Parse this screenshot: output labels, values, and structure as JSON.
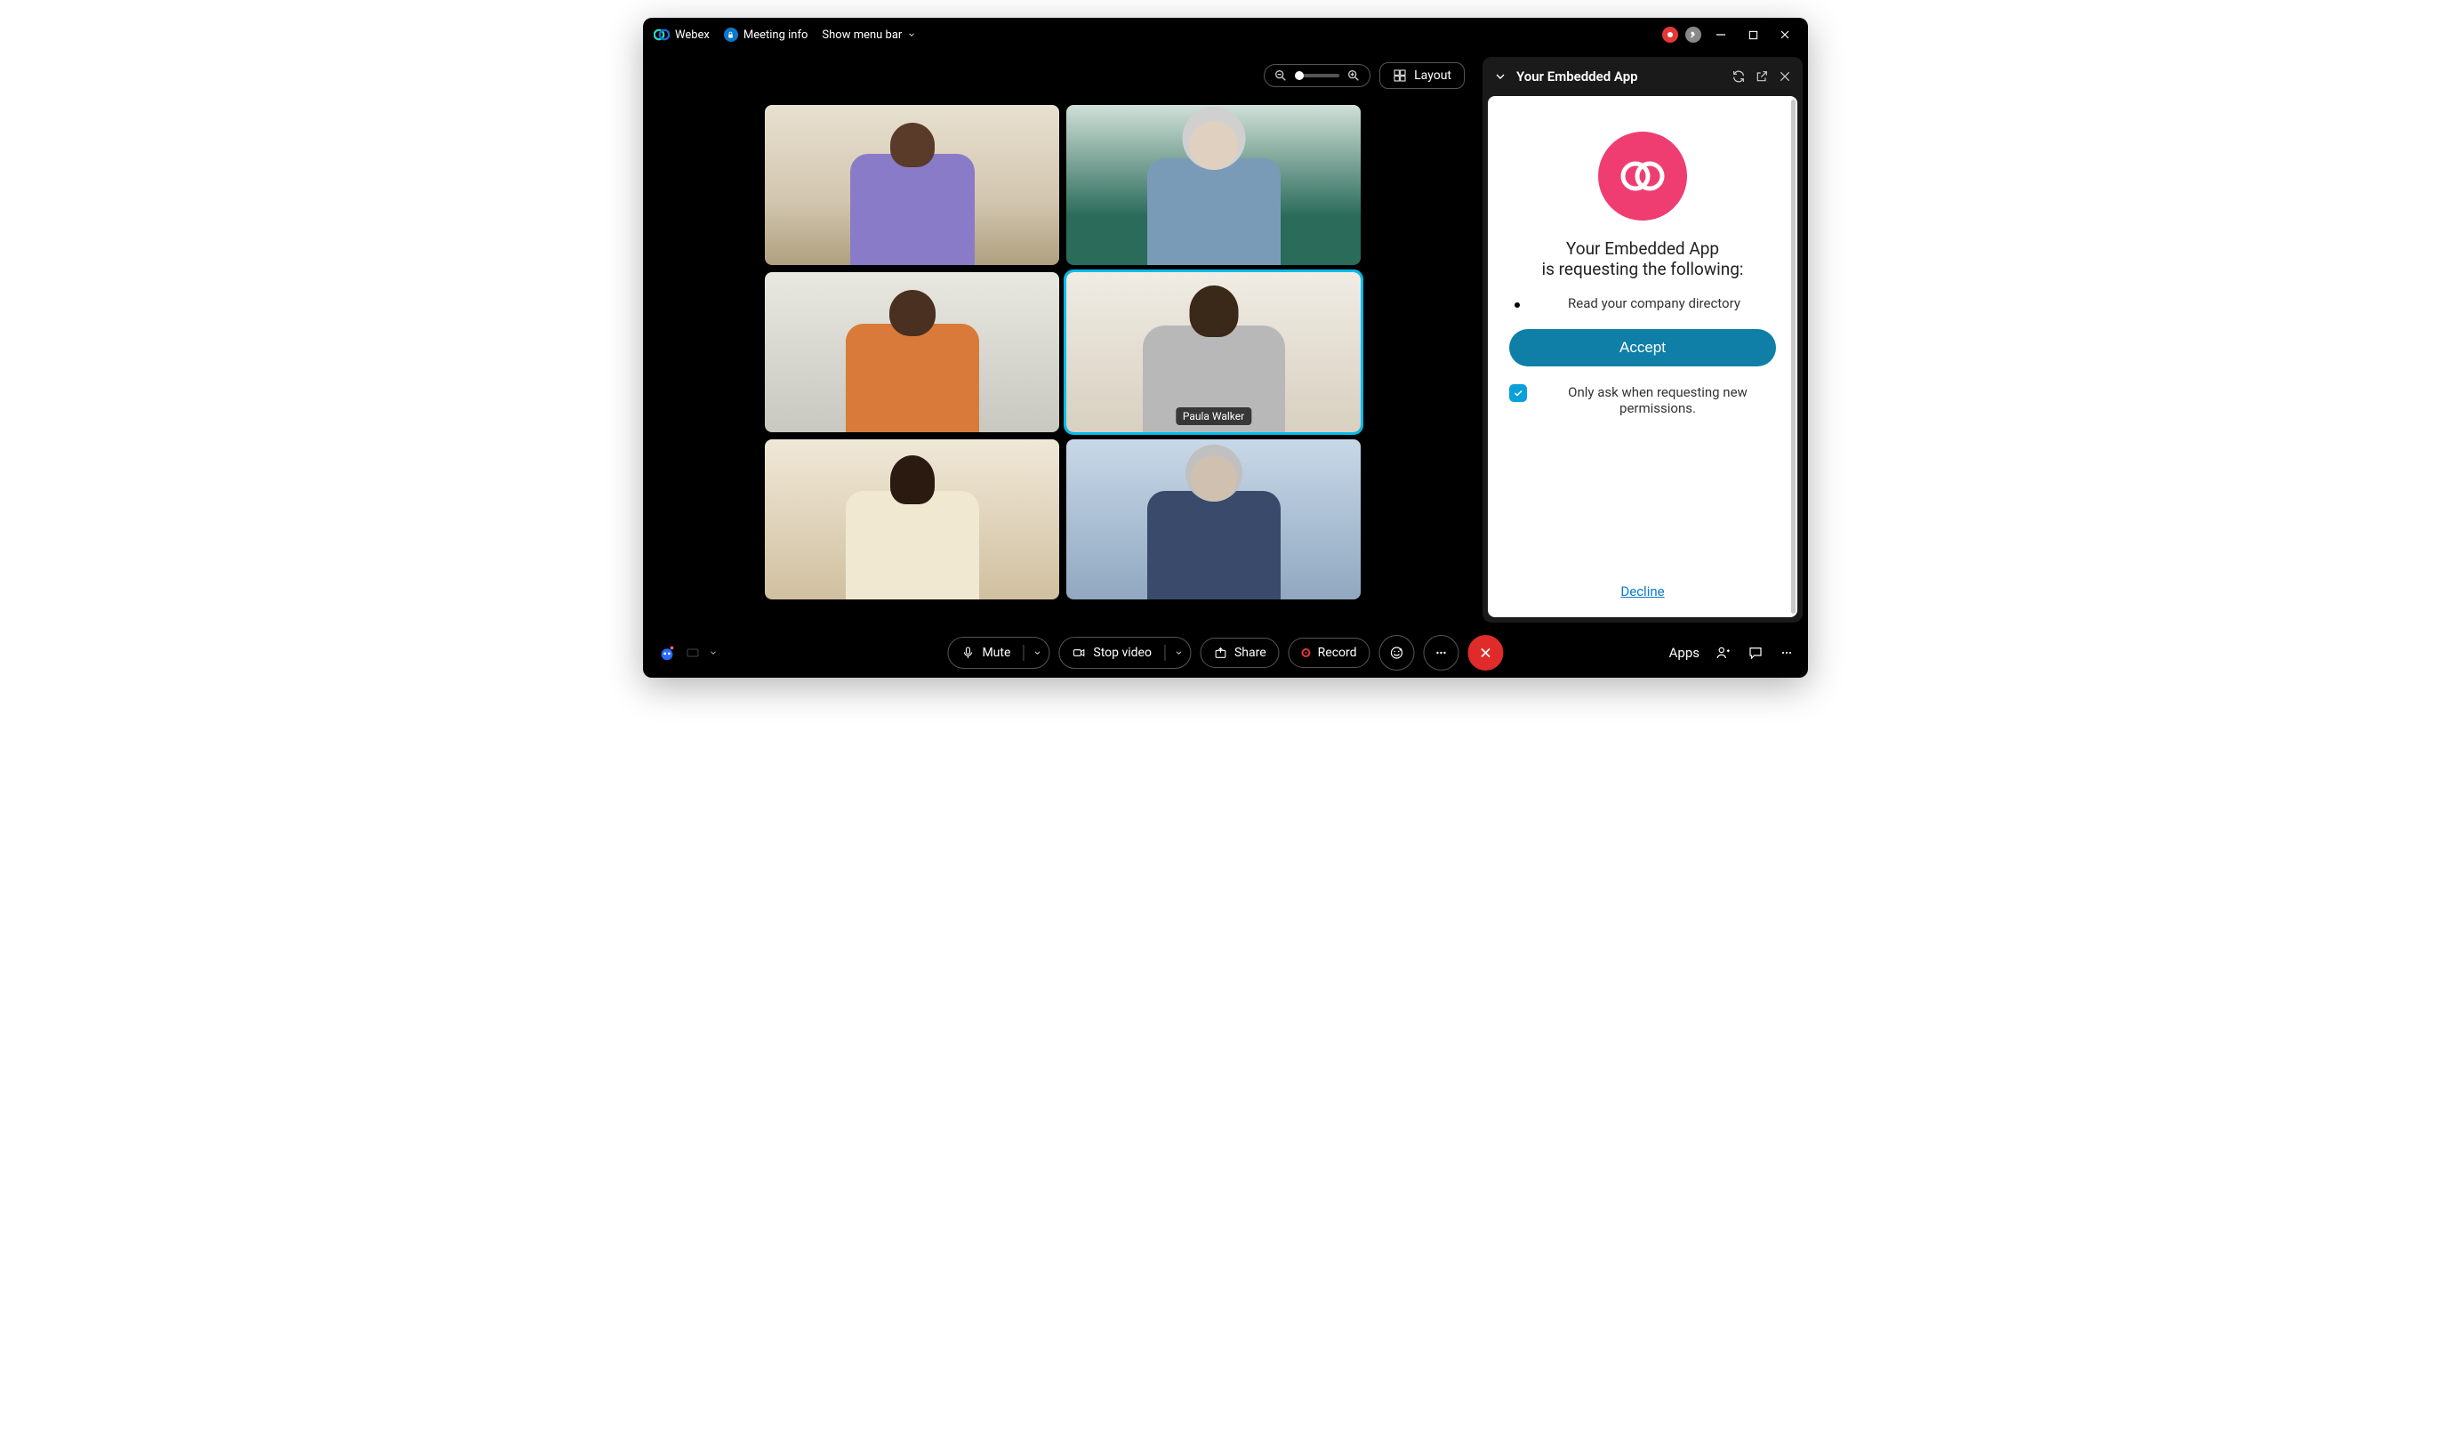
{
  "titlebar": {
    "app_name": "Webex",
    "meeting_info_label": "Meeting info",
    "show_menu_label": "Show menu bar"
  },
  "top_controls": {
    "layout_label": "Layout"
  },
  "participants": [
    {
      "name": ""
    },
    {
      "name": ""
    },
    {
      "name": ""
    },
    {
      "name": "Paula Walker",
      "active": true
    },
    {
      "name": ""
    },
    {
      "name": ""
    }
  ],
  "side_panel": {
    "title": "Your Embedded App",
    "app_name": "Your Embedded App",
    "request_line": "is requesting the following:",
    "permissions": [
      "Read your company directory"
    ],
    "accept_label": "Accept",
    "only_ask_label": "Only ask when requesting new permissions.",
    "only_ask_checked": true,
    "decline_label": "Decline"
  },
  "bottombar": {
    "mute_label": "Mute",
    "stop_video_label": "Stop video",
    "share_label": "Share",
    "record_label": "Record",
    "apps_label": "Apps"
  }
}
